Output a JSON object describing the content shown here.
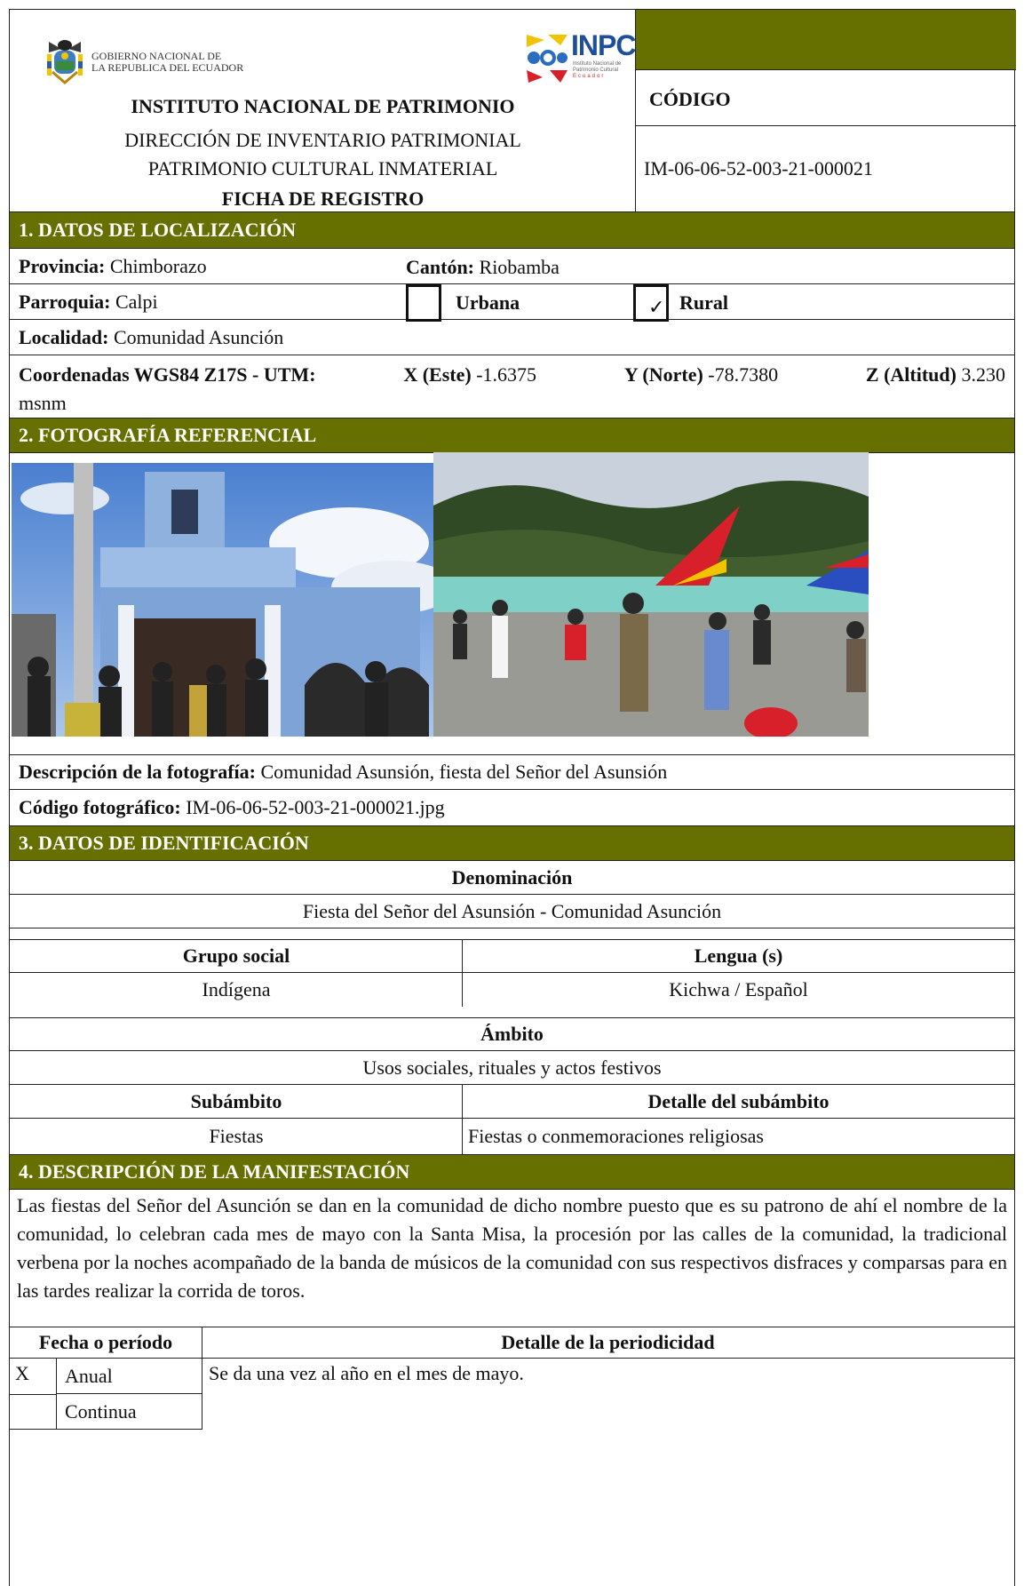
{
  "header": {
    "gov_line1": "GOBIERNO NACIONAL DE",
    "gov_line2": "LA REPUBLICA DEL ECUADOR",
    "inpc_logo": "INPC",
    "inpc_sub1": "Instituto Nacional de",
    "inpc_sub2": "Patrimonio Cultural",
    "inpc_sub3": "Ecuador",
    "title": "INSTITUTO NACIONAL DE PATRIMONIO",
    "line2": "DIRECCIÓN DE INVENTARIO PATRIMONIAL",
    "line3": "PATRIMONIO CULTURAL INMATERIAL",
    "line4": "FICHA DE REGISTRO",
    "codigo_label": "CÓDIGO",
    "codigo_value": "IM-06-06-52-003-21-000021",
    "accent_color": "#667000"
  },
  "section1": {
    "title": "1. DATOS DE LOCALIZACIÓN",
    "provincia_label": "Provincia:",
    "provincia": "Chimborazo",
    "canton_label": "Cantón:",
    "canton": "Riobamba",
    "parroquia_label": "Parroquia:",
    "parroquia": "Calpi",
    "urbana_label": "Urbana",
    "rural_label": "Rural",
    "rural_check": "✓",
    "localidad_label": "Localidad:",
    "localidad": "Comunidad Asunción",
    "coord_label": "Coordenadas WGS84 Z17S - UTM:",
    "x_label": "X (Este)",
    "x_value": "-1.6375",
    "y_label": "Y (Norte)",
    "y_value": "-78.7380",
    "z_label": "Z (Altitud)",
    "z_value": "3.230",
    "z_unit": "msnm"
  },
  "section2": {
    "title": "2. FOTOGRAFÍA REFERENCIAL",
    "desc_label": "Descripción de la fotografía:",
    "desc": "Comunidad Asunsión, fiesta del Señor del Asunsión",
    "code_label": "Código fotográfico:",
    "code": "IM-06-06-52-003-21-000021.jpg"
  },
  "section3": {
    "title": "3. DATOS DE IDENTIFICACIÓN",
    "denominacion_label": "Denominación",
    "denominacion": "Fiesta del Señor del Asunsión - Comunidad Asunción",
    "grupo_label": "Grupo social",
    "grupo": "Indígena",
    "lengua_label": "Lengua (s)",
    "lengua": "Kichwa / Español",
    "ambito_label": "Ámbito",
    "ambito": "Usos sociales, rituales y actos festivos",
    "subambito_label": "Subámbito",
    "subambito": "Fiestas",
    "detalle_label": "Detalle del subámbito",
    "detalle": "Fiestas o conmemoraciones religiosas"
  },
  "section4": {
    "title": "4. DESCRIPCIÓN DE LA MANIFESTACIÓN",
    "text": "Las fiestas del Señor del Asunción se dan en la comunidad de dicho nombre puesto que es su patrono de ahí el nombre de la comunidad, lo celebran cada mes de mayo con la Santa Misa, la procesión por las calles de la comunidad, la tradicional verbena por la noches acompañado de la banda de músicos de la comunidad con sus respectivos disfraces y comparsas para en las tardes realizar la corrida de toros.",
    "fecha_label": "Fecha o período",
    "periodicidad_label": "Detalle de la periodicidad",
    "mark_x": "X",
    "anual": "Anual",
    "continua": "Continua",
    "periodicidad_detail": "Se da una vez al año en el mes de mayo."
  }
}
